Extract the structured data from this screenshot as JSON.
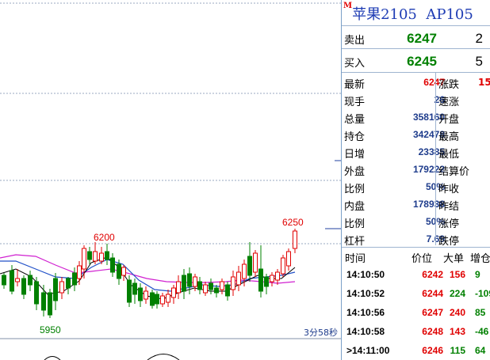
{
  "chart": {
    "high_label": "6200",
    "low_label": "5950",
    "last_high_label": "6250",
    "countdown": "3分58秒",
    "colors": {
      "up": "#e00000",
      "down": "#008000",
      "ma1": "#000000",
      "ma2": "#d020d0",
      "ma3": "#2050c8",
      "grid": "#9aa8c0"
    }
  },
  "quote": {
    "title": "苹果2105",
    "code": "AP105",
    "title_mark": "M",
    "ask": {
      "label": "卖出",
      "price": "6247",
      "volume": "2"
    },
    "bid": {
      "label": "买入",
      "price": "6245",
      "volume": "5"
    },
    "stats": [
      {
        "label": "最新",
        "value": "6247",
        "value_color": "#e00000",
        "label2": "涨跌",
        "value2": "15"
      },
      {
        "label": "现手",
        "value": "26",
        "value_color": "#1e3c8c",
        "label2": "速涨",
        "value2": ""
      },
      {
        "label": "总量",
        "value": "358160",
        "value_color": "#1e3c8c",
        "label2": "开盘",
        "value2": ""
      },
      {
        "label": "持仓",
        "value": "342478",
        "value_color": "#1e3c8c",
        "label2": "最高",
        "value2": ""
      },
      {
        "label": "日增",
        "value": "23385",
        "value_color": "#1e3c8c",
        "label2": "最低",
        "value2": ""
      },
      {
        "label": "外盘",
        "value": "179222",
        "value_color": "#1e3c8c",
        "label2": "结算价",
        "value2": ""
      },
      {
        "label": "比例",
        "value": "50%",
        "value_color": "#1e3c8c",
        "label2": "昨收",
        "value2": ""
      },
      {
        "label": "内盘",
        "value": "178938",
        "value_color": "#1e3c8c",
        "label2": "昨结",
        "value2": ""
      },
      {
        "label": "比例",
        "value": "50%",
        "value_color": "#1e3c8c",
        "label2": "涨停",
        "value2": ""
      },
      {
        "label": "杠杆",
        "value": "7.69",
        "value_color": "#1e3c8c",
        "label2": "跌停",
        "value2": ""
      }
    ],
    "ticks_header": {
      "time": "时间",
      "price": "价位",
      "size": "大单",
      "delta": "增仓"
    },
    "ticks": [
      {
        "time": "14:10:50",
        "price": "6242",
        "size": "156",
        "size_color": "#e00000",
        "delta": "9"
      },
      {
        "time": "14:10:52",
        "price": "6244",
        "size": "224",
        "size_color": "#008000",
        "delta": "-109"
      },
      {
        "time": "14:10:56",
        "price": "6247",
        "size": "240",
        "size_color": "#e00000",
        "delta": "85"
      },
      {
        "time": "14:10:58",
        "price": "6248",
        "size": "143",
        "size_color": "#e00000",
        "delta": "-46"
      },
      {
        "time": ">14:11:00",
        "price": "6246",
        "size": "115",
        "size_color": "#008000",
        "delta": "64"
      }
    ]
  }
}
